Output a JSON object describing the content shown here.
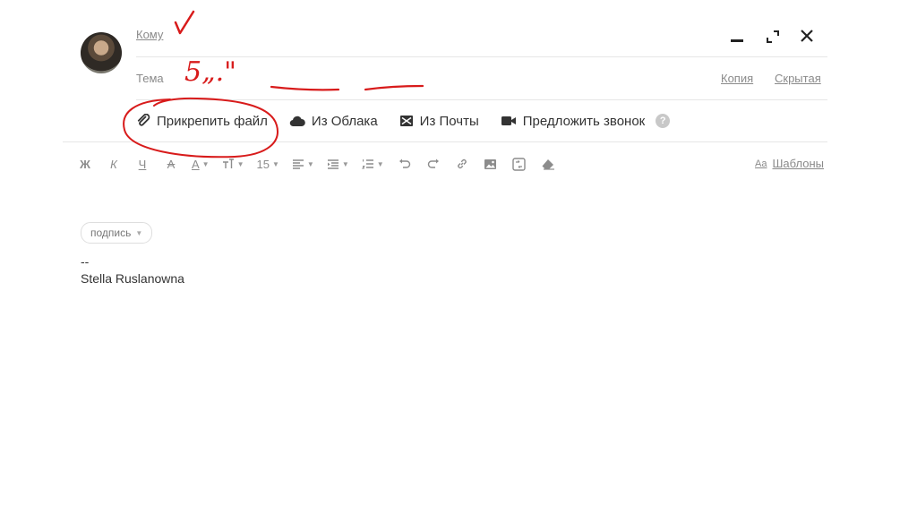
{
  "compose": {
    "to_label": "Кому",
    "subject_label": "Тема",
    "cc_label": "Копия",
    "bcc_label": "Скрытая"
  },
  "attach": {
    "file": "Прикрепить файл",
    "cloud": "Из Облака",
    "mail": "Из Почты",
    "call": "Предложить звонок",
    "help": "?"
  },
  "toolbar": {
    "bold": "Ж",
    "italic": "К",
    "underline": "Ч",
    "strike": "А",
    "color": "А",
    "font_size_value": "15",
    "templates": "Шаблоны",
    "templates_icon": "Aa"
  },
  "signature": {
    "pill_label": "подпись",
    "dash": "--",
    "name": "Stella Ruslanowna"
  },
  "annotations": {
    "subject_handwriting": "5„.\""
  },
  "colors": {
    "ink": "#d81b1b",
    "text": "#333333",
    "muted": "#8a8a8a",
    "divider": "#e6e6e6"
  }
}
